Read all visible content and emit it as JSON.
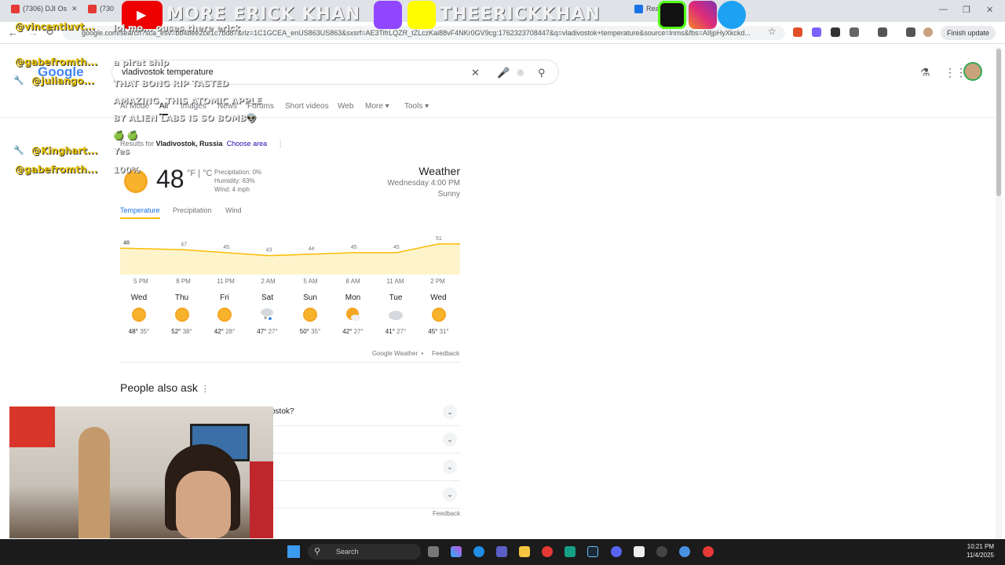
{
  "browser": {
    "tabs": [
      {
        "label": "(7306) DJI Os"
      },
      {
        "label": "(730"
      },
      {
        "label": "Real"
      }
    ],
    "url": "google.com/search?sca_esv=bb4bee2ce1c7bd87&rlz=1C1GCEA_enUS863US863&sxsrf=AE3TifrLQZR_tZLczKai88vF4NKr0GV9cg:1762323708447&q=vladivostok+temperature&source=lnms&fbs=AIIjpHyXkckd...",
    "finish_update": "Finish update"
  },
  "google": {
    "logo": "Google",
    "query": "vladivostok temperature",
    "tabs": [
      "AI Mode",
      "All",
      "Images",
      "News",
      "Forums",
      "Short videos",
      "Web",
      "More",
      "Tools"
    ]
  },
  "weather": {
    "results_prefix": "Results for",
    "location": "Vladivostok, Russia",
    "choose_area": "Choose area",
    "temp": "48",
    "units": "°F | °C",
    "precipitation": "Precipitation: 0%",
    "humidity": "Humidity: 63%",
    "wind": "Wind: 4 mph",
    "title": "Weather",
    "time": "Wednesday 4:00 PM",
    "condition": "Sunny",
    "tabs": [
      "Temperature",
      "Precipitation",
      "Wind"
    ],
    "google_weather": "Google Weather",
    "feedback": "Feedback",
    "days": [
      {
        "name": "Wed",
        "hi": "48°",
        "lo": "35°",
        "icon": "sunny"
      },
      {
        "name": "Thu",
        "hi": "52°",
        "lo": "38°",
        "icon": "sunny"
      },
      {
        "name": "Fri",
        "hi": "42°",
        "lo": "28°",
        "icon": "sunny"
      },
      {
        "name": "Sat",
        "hi": "47°",
        "lo": "27°",
        "icon": "snow-showers"
      },
      {
        "name": "Sun",
        "hi": "50°",
        "lo": "35°",
        "icon": "sunny"
      },
      {
        "name": "Mon",
        "hi": "42°",
        "lo": "27°",
        "icon": "partly-cloudy"
      },
      {
        "name": "Tue",
        "hi": "41°",
        "lo": "27°",
        "icon": "cloudy"
      },
      {
        "name": "Wed",
        "hi": "45°",
        "lo": "31°",
        "icon": "sunny"
      }
    ]
  },
  "chart_data": {
    "type": "area",
    "x": [
      "5 PM",
      "8 PM",
      "11 PM",
      "2 AM",
      "5 AM",
      "8 AM",
      "11 AM",
      "2 PM"
    ],
    "values": [
      48,
      47,
      45,
      43,
      44,
      45,
      45,
      51
    ],
    "ylim": [
      30,
      60
    ],
    "color": "#fbbc04"
  },
  "paa": {
    "title": "People also ask",
    "questions": [
      "ostok?",
      "",
      "",
      ""
    ],
    "feedback": "Feedback"
  },
  "overlay": {
    "banner_left": "MORE ERICK KHAN",
    "banner_right": "THEERICKKHAN",
    "chat": [
      {
        "user": "@vincentluvt...",
        "msg": "lol mo... ouses there erick"
      },
      {
        "user": "@gabefromth...",
        "msg": "a pirat ship"
      },
      {
        "user": "@juliango...",
        "msg": "THAT BONG RIP TASTED AMAZING, THIS ATOMIC APPLE BY ALIEN LABS IS SO BOMB👽 🍏 🍏"
      },
      {
        "user": "@Kinghart...",
        "msg": "Yes"
      },
      {
        "user": "@gabefromth...",
        "msg": "100%"
      }
    ]
  },
  "taskbar": {
    "search": "Search",
    "time": "10:21 PM",
    "date": "11/4/2025"
  }
}
